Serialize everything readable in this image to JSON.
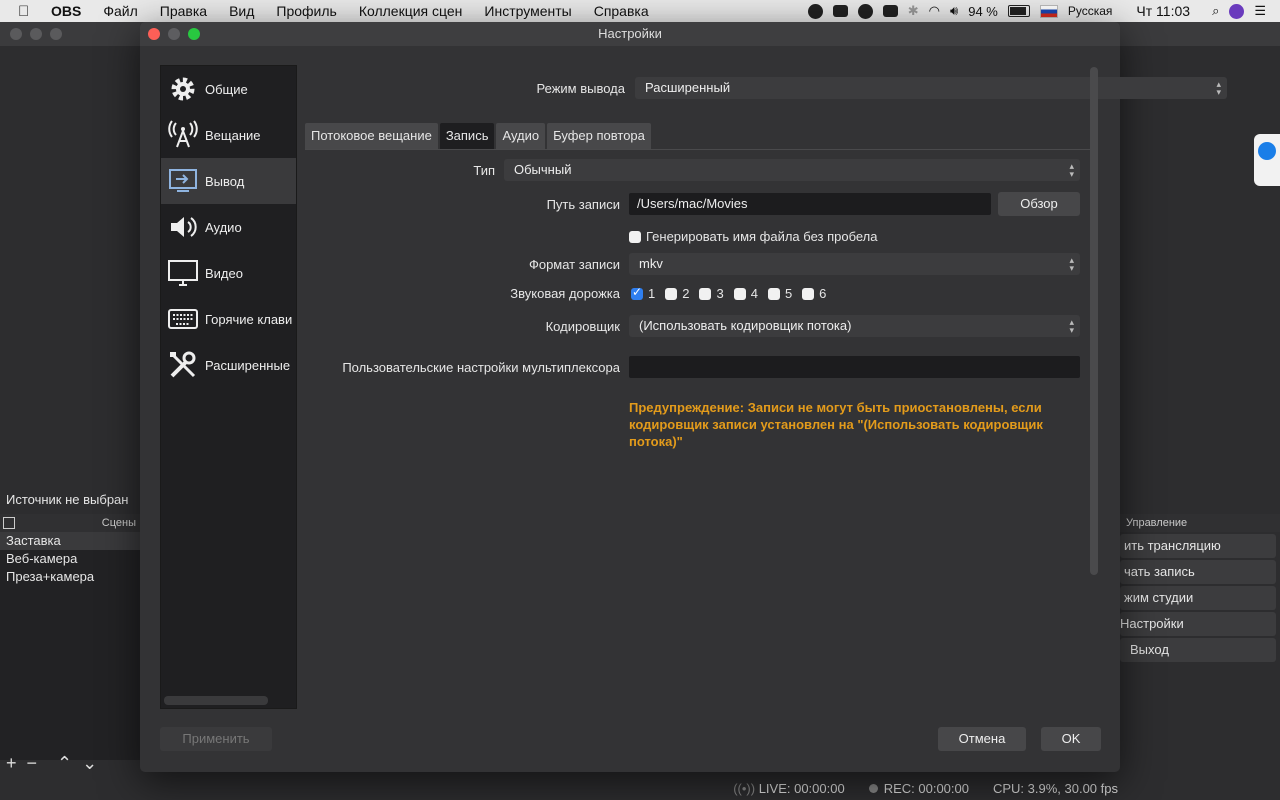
{
  "menubar": {
    "app": "OBS",
    "items": [
      "Файл",
      "Правка",
      "Вид",
      "Профиль",
      "Коллекция сцен",
      "Инструменты",
      "Справка"
    ],
    "battery": "94 %",
    "input_source": "Русская",
    "clock": "Чт 11:03"
  },
  "main_window": {
    "no_source": "Источник не выбран",
    "scenes_header": "Сцены",
    "scenes": [
      "Заставка",
      "Веб-камера",
      "Преза+камера"
    ],
    "controls_header": "Управление",
    "controls": [
      "ить трансляцию",
      "чать запись",
      "жим студии",
      "Настройки",
      "Выход"
    ],
    "status": {
      "live": "LIVE: 00:00:00",
      "rec": "REC: 00:00:00",
      "cpu": "CPU: 3.9%, 30.00 fps"
    }
  },
  "dialog": {
    "title": "Настройки",
    "sidebar": [
      {
        "label": "Общие",
        "icon": "gear-icon"
      },
      {
        "label": "Вещание",
        "icon": "broadcast-icon"
      },
      {
        "label": "Вывод",
        "icon": "output-icon"
      },
      {
        "label": "Аудио",
        "icon": "speaker-icon"
      },
      {
        "label": "Видео",
        "icon": "monitor-icon"
      },
      {
        "label": "Горячие клави",
        "icon": "keyboard-icon"
      },
      {
        "label": "Расширенные",
        "icon": "tools-icon"
      }
    ],
    "output_mode_label": "Режим вывода",
    "output_mode_value": "Расширенный",
    "tabs": [
      "Потоковое вещание",
      "Запись",
      "Аудио",
      "Буфер повтора"
    ],
    "type_label": "Тип",
    "type_value": "Обычный",
    "path_label": "Путь записи",
    "path_value": "/Users/mac/Movies",
    "browse": "Обзор",
    "no_space_label": "Генерировать имя файла без пробела",
    "format_label": "Формат записи",
    "format_value": "mkv",
    "tracks_label": "Звуковая дорожка",
    "tracks": [
      {
        "label": "1",
        "checked": true
      },
      {
        "label": "2",
        "checked": false
      },
      {
        "label": "3",
        "checked": false
      },
      {
        "label": "4",
        "checked": false
      },
      {
        "label": "5",
        "checked": false
      },
      {
        "label": "6",
        "checked": false
      }
    ],
    "encoder_label": "Кодировщик",
    "encoder_value": "(Использовать кодировщик потока)",
    "mux_label": "Пользовательские настройки мультиплексора",
    "mux_value": "",
    "warning": "Предупреждение: Записи не могут быть приостановлены, если кодировщик записи установлен на \"(Использовать кодировщик потока)\"",
    "apply": "Применить",
    "cancel": "Отмена",
    "ok": "OK"
  }
}
